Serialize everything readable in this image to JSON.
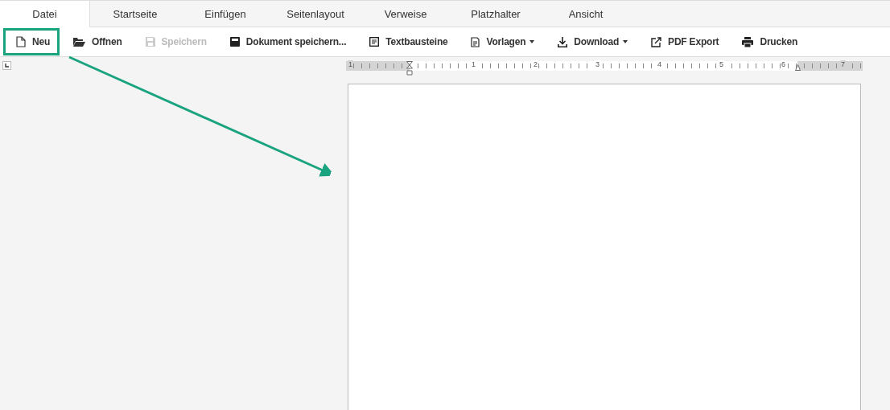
{
  "tabs": [
    {
      "label": "Datei",
      "selected": true
    },
    {
      "label": "Startseite",
      "selected": false
    },
    {
      "label": "Einfügen",
      "selected": false
    },
    {
      "label": "Seitenlayout",
      "selected": false
    },
    {
      "label": "Verweise",
      "selected": false
    },
    {
      "label": "Platzhalter",
      "selected": false
    },
    {
      "label": "Ansicht",
      "selected": false
    }
  ],
  "toolbar": [
    {
      "label": "Neu",
      "kind": "page",
      "disabled": false,
      "dropdown": false,
      "highlighted": true
    },
    {
      "label": "Offnen",
      "kind": "folder",
      "disabled": false,
      "dropdown": false,
      "highlighted": false
    },
    {
      "label": "Speichern",
      "kind": "save",
      "disabled": true,
      "dropdown": false,
      "highlighted": false
    },
    {
      "label": "Dokument speichern...",
      "kind": "save-as",
      "disabled": false,
      "dropdown": false,
      "highlighted": false
    },
    {
      "label": "Textbausteine",
      "kind": "text-block",
      "disabled": false,
      "dropdown": false,
      "highlighted": false
    },
    {
      "label": "Vorlagen",
      "kind": "template",
      "disabled": false,
      "dropdown": true,
      "highlighted": false
    },
    {
      "label": "Download",
      "kind": "download",
      "disabled": false,
      "dropdown": true,
      "highlighted": false
    },
    {
      "label": "PDF Export",
      "kind": "export",
      "disabled": false,
      "dropdown": false,
      "highlighted": false
    },
    {
      "label": "Drucken",
      "kind": "print",
      "disabled": false,
      "dropdown": false,
      "highlighted": false
    }
  ],
  "ruler": {
    "labels": [
      "1",
      "1",
      "2",
      "3",
      "4",
      "5",
      "6",
      "7"
    ]
  }
}
